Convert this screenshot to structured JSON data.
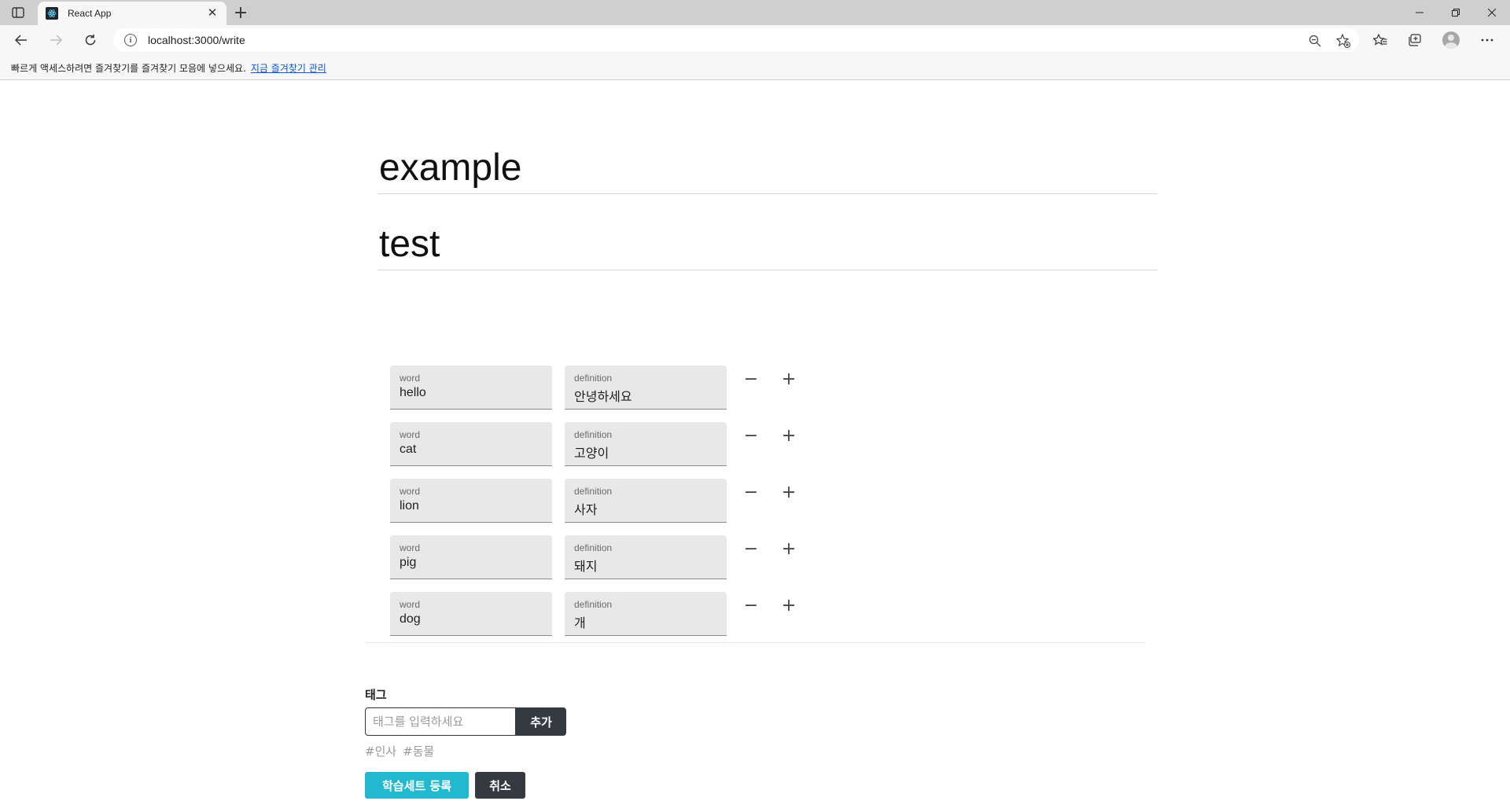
{
  "browser": {
    "tab_title": "React App",
    "tab_close": "✕",
    "new_tab": "+",
    "url": "localhost:3000/write",
    "favorites_prompt": "빠르게 액세스하려면 즐겨찾기를 즐겨찾기 모음에 넣으세요.",
    "favorites_link": "지금 즐겨찾기 관리",
    "icons": [
      "sidebar-icon",
      "react-favicon",
      "back-icon",
      "forward-icon",
      "refresh-icon",
      "info-icon",
      "zoom-icon",
      "add-favorite-icon",
      "favorites-icon",
      "collections-icon",
      "profile-icon",
      "more-icon",
      "minimize-icon",
      "restore-icon",
      "close-icon"
    ]
  },
  "editor": {
    "title": "example",
    "description": "test"
  },
  "cards": [
    {
      "word_label": "word",
      "word": "hello",
      "definition_label": "definition",
      "definition": "안녕하세요"
    },
    {
      "word_label": "word",
      "word": "cat",
      "definition_label": "definition",
      "definition": "고양이"
    },
    {
      "word_label": "word",
      "word": "lion",
      "definition_label": "definition",
      "definition": "사자"
    },
    {
      "word_label": "word",
      "word": "pig",
      "definition_label": "definition",
      "definition": "돼지"
    },
    {
      "word_label": "word",
      "word": "dog",
      "definition_label": "definition",
      "definition": "개"
    }
  ],
  "row_actions": {
    "remove": "−",
    "add": "+"
  },
  "tags": {
    "heading": "태그",
    "placeholder": "태그를 입력하세요",
    "add_label": "추가",
    "items": [
      "#인사",
      "#동물"
    ]
  },
  "actions": {
    "submit_label": "학습세트 등록",
    "cancel_label": "취소"
  },
  "colors": {
    "submit": "#22b8cf",
    "dark_button": "#343a40",
    "field_bg": "#e8e8e8"
  }
}
